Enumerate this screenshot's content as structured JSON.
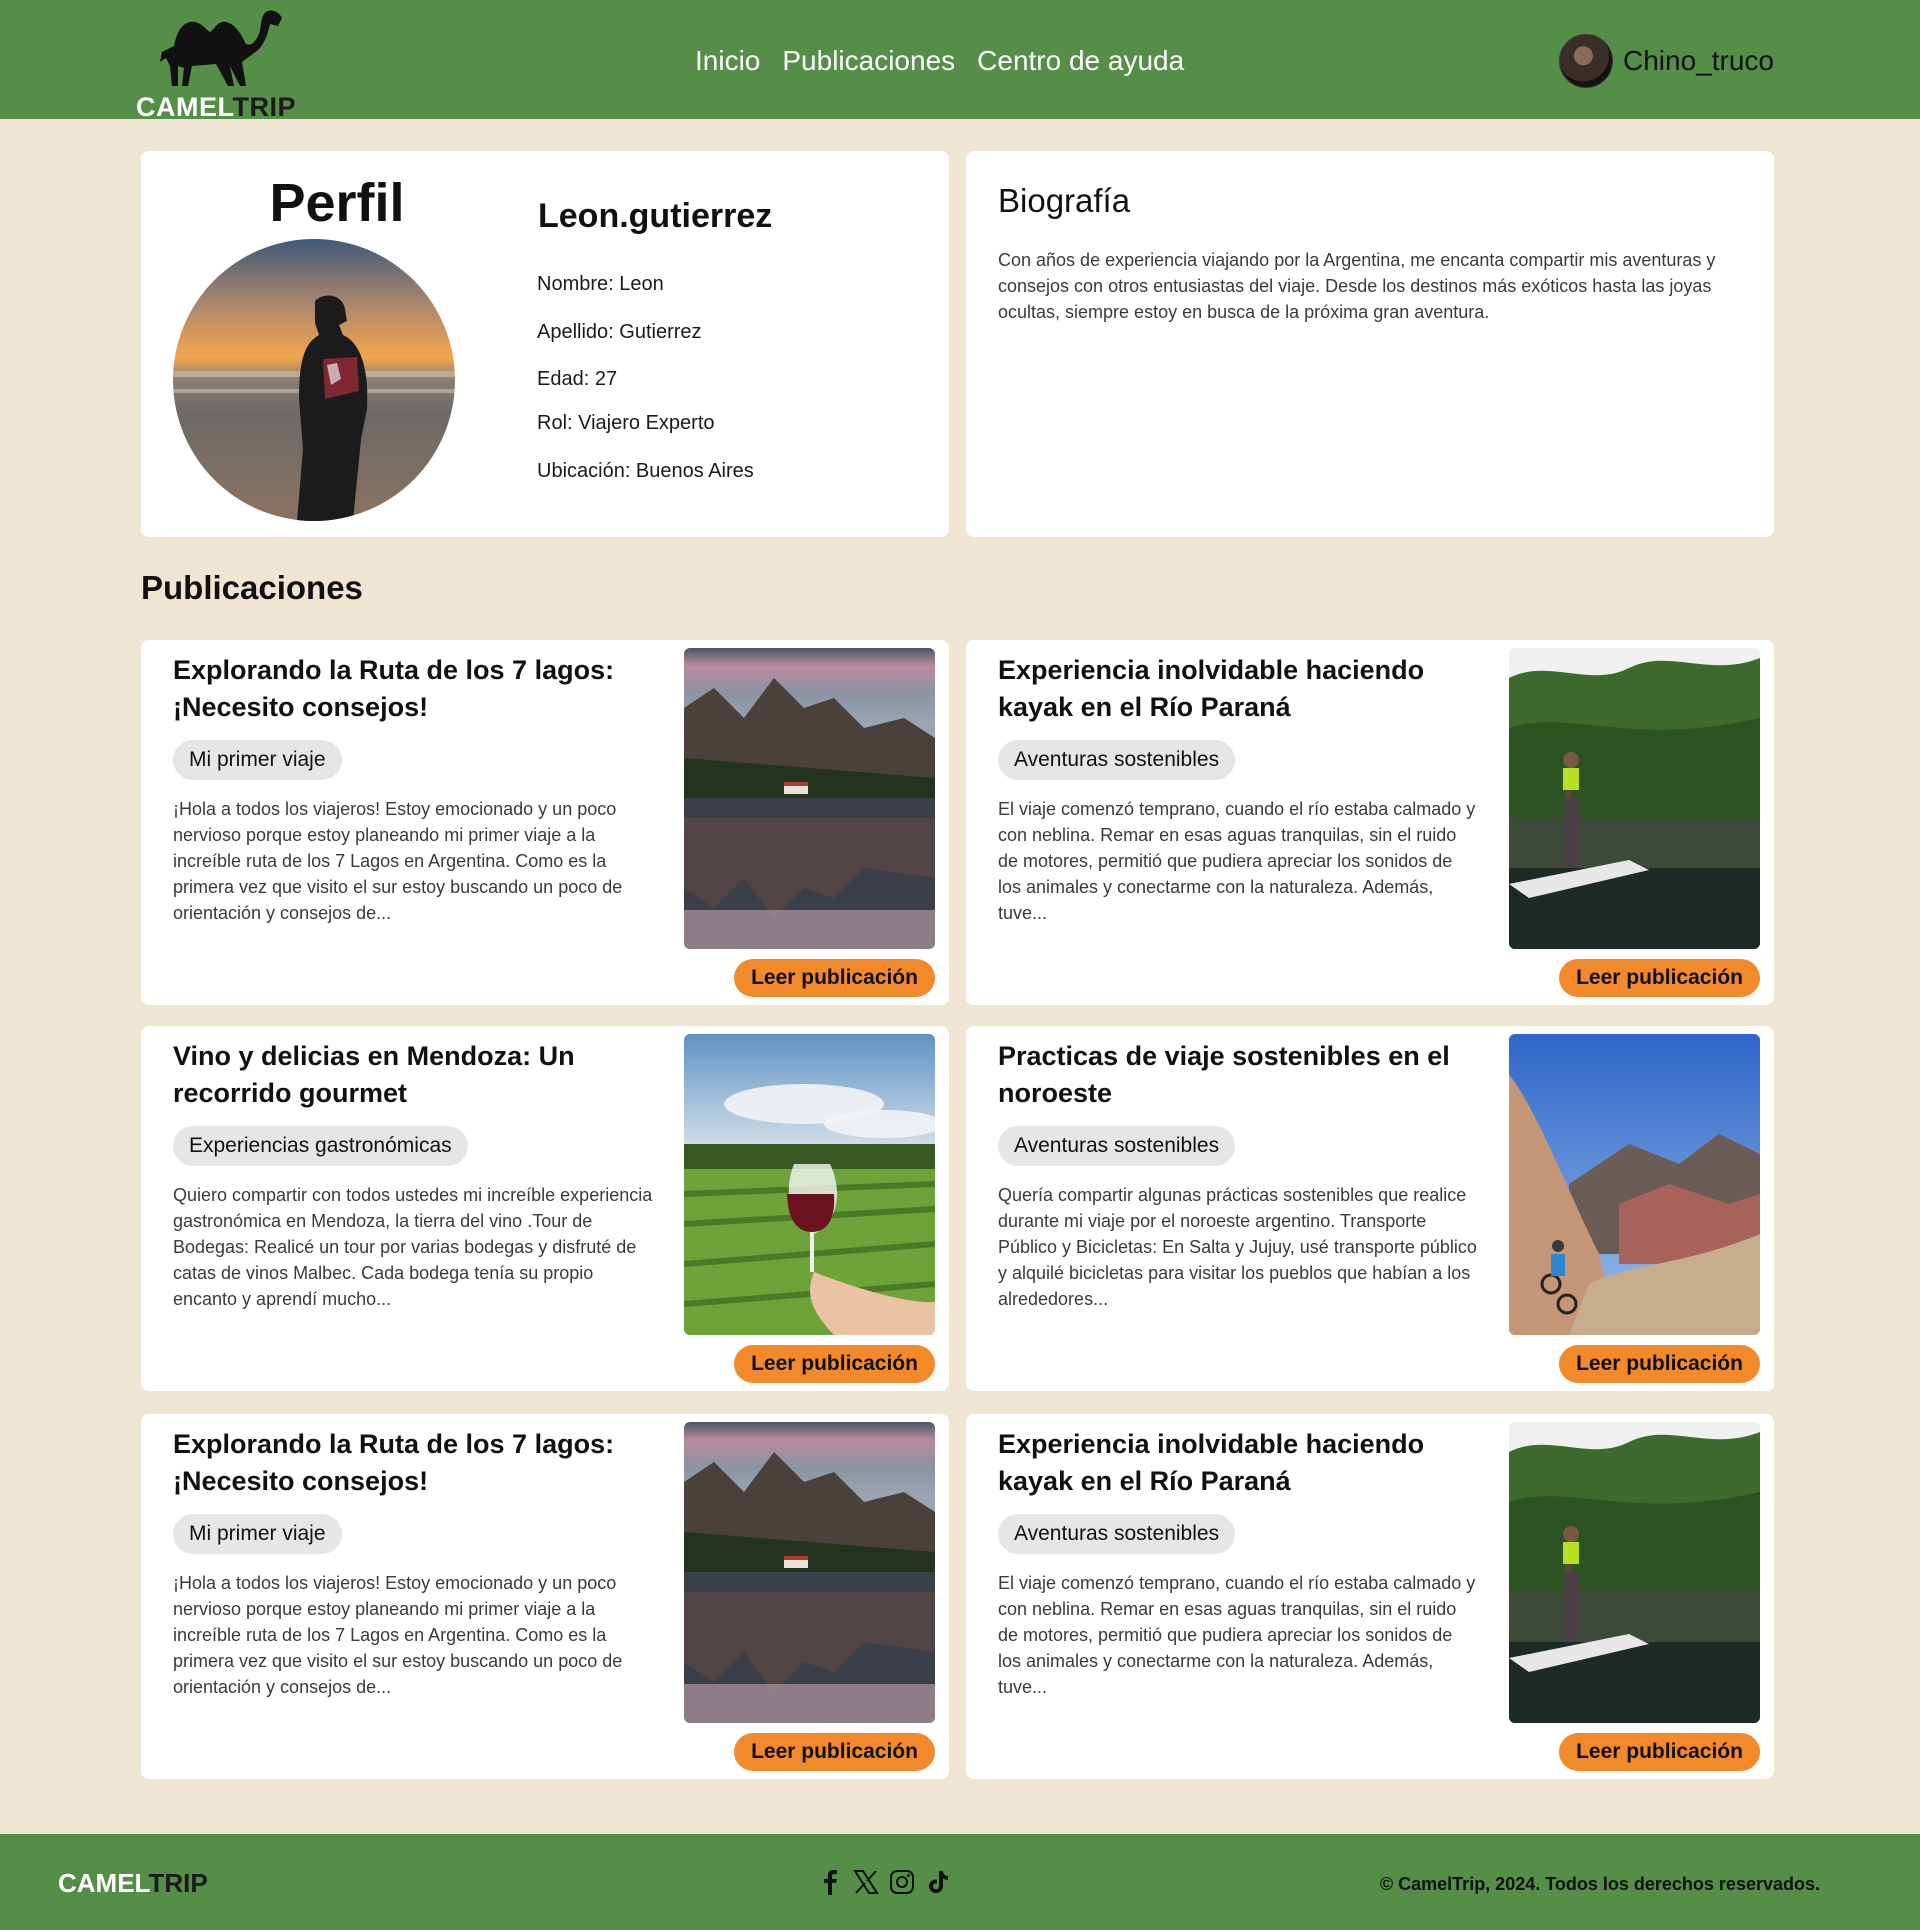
{
  "header": {
    "logo": {
      "part1": "CAMEL",
      "part2": "TRIP"
    },
    "nav": [
      "Inicio",
      "Publicaciones",
      "Centro de ayuda"
    ],
    "user": {
      "name": "Chino_truco"
    }
  },
  "profile": {
    "title": "Perfil",
    "username": "Leon.gutierrez",
    "fields": [
      "Nombre: Leon",
      "Apellido: Gutierrez",
      "Edad: 27",
      "Rol: Viajero Experto",
      "Ubicación: Buenos Aires"
    ]
  },
  "bio": {
    "title": "Biografía",
    "text": "Con años de experiencia viajando por la Argentina, me encanta compartir mis aventuras y consejos con otros entusiastas del viaje. Desde los destinos más exóticos hasta las joyas ocultas, siempre estoy en busca de la próxima gran aventura."
  },
  "posts_section": {
    "title": "Publicaciones",
    "button_label": "Leer publicación",
    "items": [
      {
        "title": "Explorando la Ruta de los 7 lagos: ¡Necesito consejos!",
        "tag": "Mi primer viaje",
        "excerpt": "¡Hola a todos los viajeros! Estoy emocionado y un poco nervioso porque estoy planeando mi primer viaje a la increíble ruta de los 7 Lagos en Argentina. Como es la primera vez que visito el sur estoy buscando un poco de orientación y consejos de...",
        "image": "lake-reflection"
      },
      {
        "title": "Experiencia inolvidable haciendo kayak en el Río Paraná",
        "tag": "Aventuras sostenibles",
        "excerpt": "El viaje comenzó temprano, cuando el río estaba calmado y con neblina. Remar en esas aguas tranquilas, sin el ruido de motores, permitió que pudiera apreciar los sonidos de los animales y conectarme con la naturaleza. Además, tuve...",
        "image": "paddle-river"
      },
      {
        "title": "Vino y delicias en Mendoza: Un recorrido gourmet",
        "tag": "Experiencias gastronómicas",
        "excerpt": "Quiero compartir con todos ustedes mi increíble experiencia gastronómica en Mendoza, la tierra del vino .Tour de Bodegas: Realicé un tour por varias bodegas y disfruté de catas de vinos Malbec. Cada bodega tenía su propio encanto y aprendí mucho...",
        "image": "wine-vineyard"
      },
      {
        "title": "Practicas de viaje sostenibles en el noroeste",
        "tag": "Aventuras sostenibles",
        "excerpt": "Quería compartir algunas prácticas sostenibles que realice durante mi viaje por el noroeste argentino. Transporte Público y Bicicletas: En Salta y Jujuy, usé transporte público y alquilé bicicletas para visitar los pueblos que habían a los alrededores...",
        "image": "mountain-bike"
      },
      {
        "title": "Explorando la Ruta de los 7 lagos: ¡Necesito consejos!",
        "tag": "Mi primer viaje",
        "excerpt": "¡Hola a todos los viajeros! Estoy emocionado y un poco nervioso porque estoy planeando mi primer viaje a la increíble ruta de los 7 Lagos en Argentina. Como es la primera vez que visito el sur estoy buscando un poco de orientación y consejos de...",
        "image": "lake-reflection"
      },
      {
        "title": "Experiencia inolvidable haciendo kayak en el Río Paraná",
        "tag": "Aventuras sostenibles",
        "excerpt": "El viaje comenzó temprano, cuando el río estaba calmado y con neblina. Remar en esas aguas tranquilas, sin el ruido de motores, permitió que pudiera apreciar los sonidos de los animales y conectarme con la naturaleza. Además, tuve...",
        "image": "paddle-river"
      }
    ]
  },
  "footer": {
    "logo": {
      "part1": "CAMEL",
      "part2": "TRIP"
    },
    "social_icons": [
      "facebook-icon",
      "x-icon",
      "instagram-icon",
      "tiktok-icon"
    ],
    "copyright": "© CamelTrip, 2024. Todos los derechos reservados."
  },
  "colors": {
    "header_bg": "#558e46",
    "page_bg": "#efe5d3",
    "button_bg": "#f28a2c",
    "tag_bg": "#e6e6e6"
  }
}
